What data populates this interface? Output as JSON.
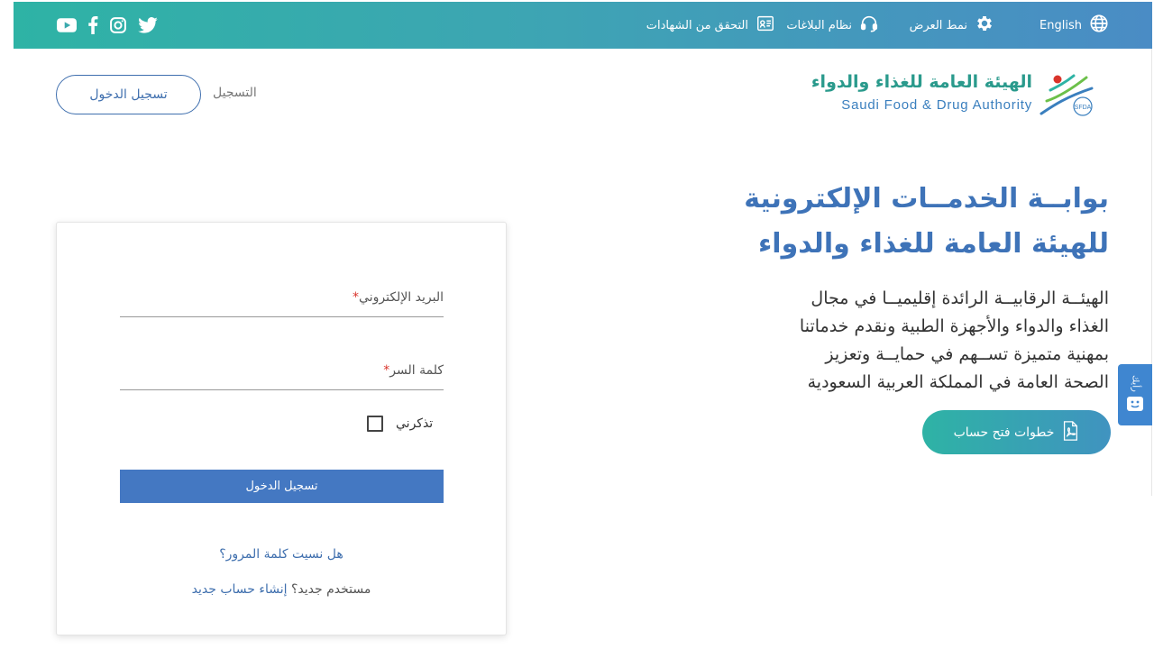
{
  "topbar": {
    "language": "English",
    "display_mode": "نمط العرض",
    "reports_system": "نظام البلاغات",
    "verify_certificates": "التحقق من الشهادات"
  },
  "header": {
    "logo_ar": "الهيئة العامة للغذاء والدواء",
    "logo_en": "Saudi Food & Drug Authority",
    "logo_badge": "SFDA",
    "login_button": "تسجيل الدخول",
    "register_link": "التسجيل"
  },
  "hero": {
    "title_line1": "بوابــة الخدمــات الإلكترونية",
    "title_line2": "للهيئة العامة للغذاء والدواء",
    "desc_line1": "الهيئــة الرقابيــة الرائدة إقليميــا في مجال",
    "desc_line2": "الغذاء والدواء والأجهزة الطبية ونقدم خدماتنا",
    "desc_line3": "بمهنية متميزة تســهم في حمايــة وتعزيز",
    "desc_line4": "الصحة العامة في المملكة العربية السعودية",
    "steps_button": "خطوات فتح حساب"
  },
  "feedback": {
    "label": "رأيك"
  },
  "login_form": {
    "email_label": "البريد الإلكتروني",
    "password_label": "كلمة السر",
    "required_mark": "*",
    "remember_label": "تذكرني",
    "submit_button": "تسجيل الدخول",
    "forgot_link": "هل نسيت كلمة المرور؟",
    "new_user_question": "مستخدم جديد؟",
    "create_account_link": "إنشاء حساب جديد"
  },
  "colors": {
    "topbar_start": "#2eb3a5",
    "topbar_end": "#4a8cc5",
    "primary_blue": "#4478c2",
    "title_blue": "#3e73b8",
    "teal": "#2a9a8c",
    "required_red": "#d9342b"
  },
  "icons": {
    "globe": "globe-icon",
    "gear": "gear-icon",
    "headset": "headset-icon",
    "certificate": "certificate-icon",
    "youtube": "youtube-icon",
    "facebook": "facebook-icon",
    "instagram": "instagram-icon",
    "twitter": "twitter-icon",
    "pdf": "pdf-icon",
    "smiley": "smiley-icon"
  }
}
